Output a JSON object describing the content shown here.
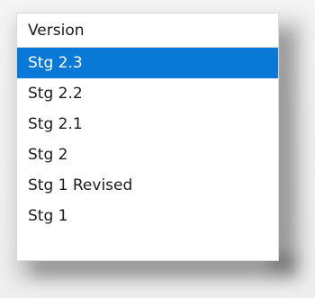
{
  "header": {
    "label": "Version"
  },
  "options": [
    {
      "label": "Stg 2.3",
      "selected": true
    },
    {
      "label": "Stg 2.2",
      "selected": false
    },
    {
      "label": "Stg 2.1",
      "selected": false
    },
    {
      "label": "Stg 2",
      "selected": false
    },
    {
      "label": "Stg 1 Revised",
      "selected": false
    },
    {
      "label": "Stg 1",
      "selected": false
    }
  ],
  "colors": {
    "selected_bg": "#0a78d7",
    "selected_text": "#ffffff",
    "text": "#1a1a1a"
  }
}
